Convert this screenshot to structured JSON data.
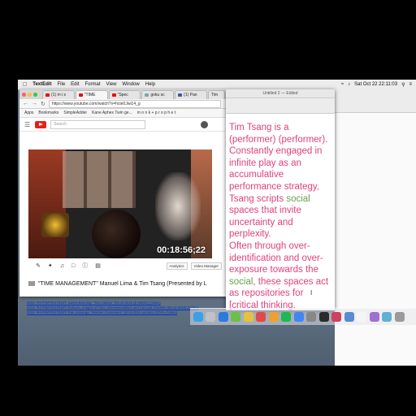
{
  "menubar": {
    "app": "TextEdit",
    "items": [
      "File",
      "Edit",
      "Format",
      "View",
      "Window",
      "Help"
    ],
    "clock": "Sat Oct 22  22:11:03"
  },
  "chrome": {
    "tabs": [
      "(1) m i s",
      "\"TIME",
      "\"Spec",
      "goku sc",
      "(1) Pan",
      "Tim"
    ],
    "url": "https://www.youtube.com/watch?v=hcte0Jwi14_g",
    "bookmarks": [
      "Apps",
      "Bookmarks",
      "SimpleAdder",
      "Kane Aphex Twin ge...",
      "m o n k + p r o p h e t"
    ],
    "search_placeholder": "Search"
  },
  "video": {
    "timestamp": "00:18:56;22",
    "analytics_label": "Analytics",
    "manager_label": "Video Manager",
    "title": "\"TIME MANAGEMENT\" Manuel Lima & Tim Tsang (Presented by L"
  },
  "textedit": {
    "window_title": "Untitled 2 — Edited",
    "line1": "Tim Tsang is a (performer) (performer).",
    "line2a": "Constantly engaged in infinite play as an accumulative performance strategy, Tsang scripts ",
    "line2_green": "social",
    "line2b": " spaces that invite uncertainty and perplexity.",
    "line3a": "Often through over-identification and over-exposure towards the ",
    "line3_green": "social",
    "line3b": ", these spaces act as repositories for [critical thinking, contemplation, and escapism] in the context of [event, game, and concert]."
  },
  "links": [
    "2015: #HYPERTEXTEDIT: James Benning: \"Two Cabins\" (03.10.2015 @ MoMA) (Video)",
    "2015: #HYPERTEXTEDIT: Deleuze, Images of Time, Dimensionalities and Concept Creation (02.13.2015) (Video)",
    "2015: #HYPERTEXTEDIT: Tom Jennings: \"Women Consumers\" (03.9.2015 Lecture) 2374% (Video)"
  ],
  "colors": {
    "pink_text": "#e0407a",
    "green_text": "#6aa04a",
    "youtube_red": "#e62117"
  }
}
